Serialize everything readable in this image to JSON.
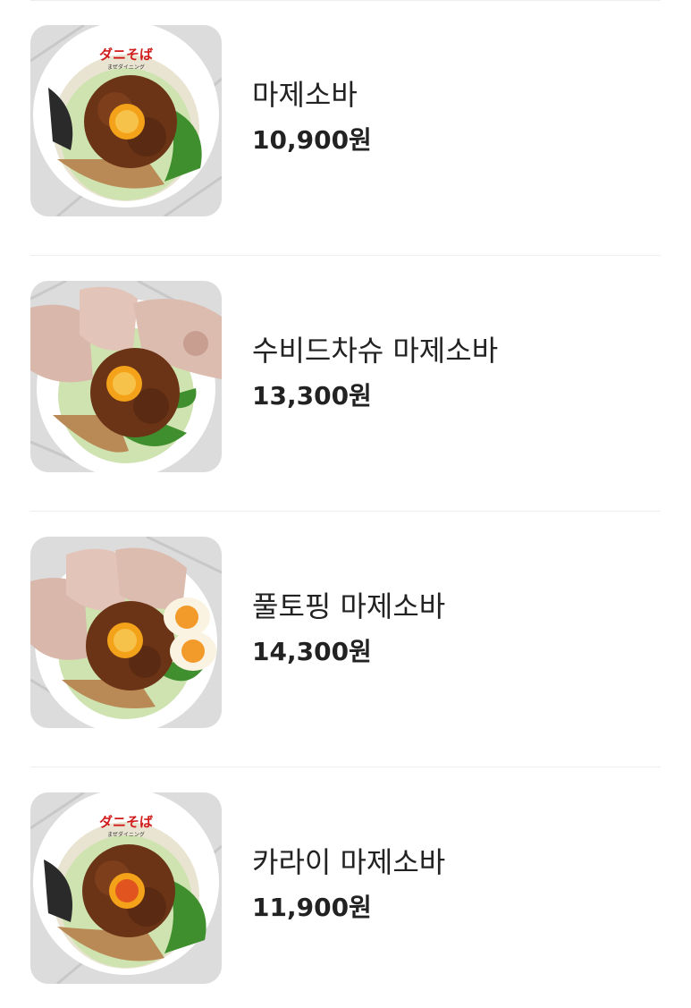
{
  "menu": {
    "items": [
      {
        "name": "마제소바",
        "price": "10,900원",
        "image": "mazesoba-bowl-logo"
      },
      {
        "name": "수비드차슈 마제소바",
        "price": "13,300원",
        "image": "sousvide-chashu-mazesoba-bowl"
      },
      {
        "name": "풀토핑 마제소바",
        "price": "14,300원",
        "image": "full-topping-mazesoba-bowl"
      },
      {
        "name": "카라이 마제소바",
        "price": "11,900원",
        "image": "karai-mazesoba-bowl-logo"
      }
    ],
    "bowl_logo_text": "ダニそば",
    "bowl_logo_subtext": "まぜダイニング"
  }
}
